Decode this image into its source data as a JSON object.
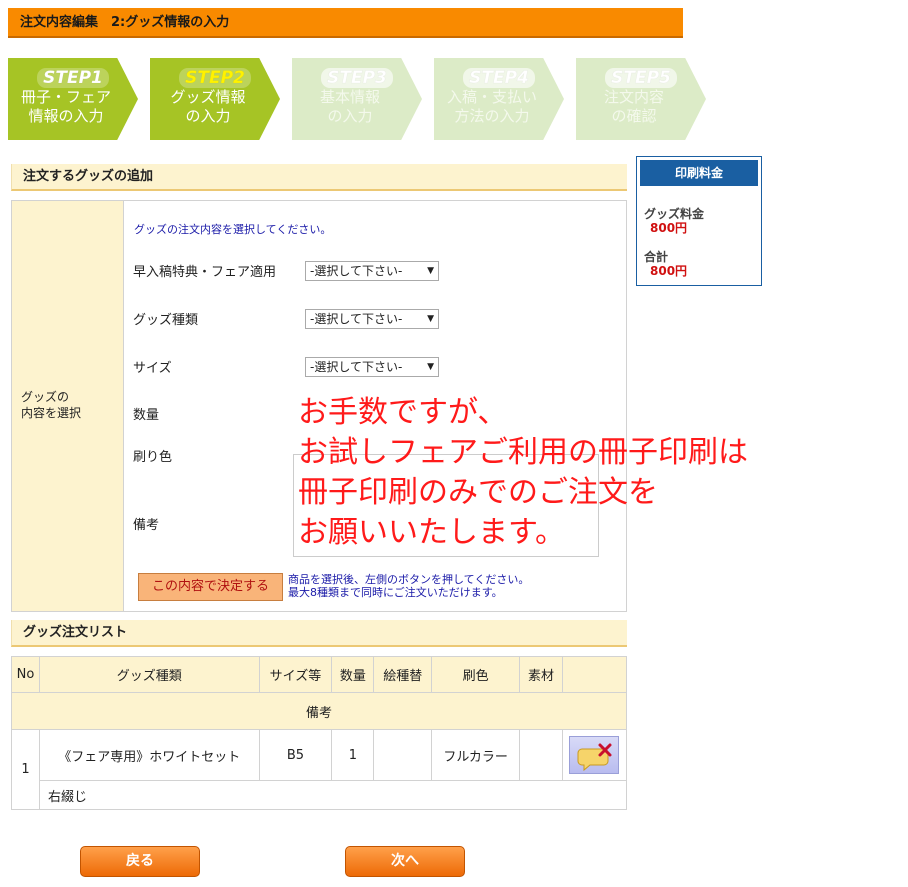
{
  "header": {
    "title": "注文内容編集　2:グッズ情報の入力"
  },
  "steps": [
    {
      "num": "STEP1",
      "line1": "冊子・フェア",
      "line2": "情報の入力"
    },
    {
      "num": "STEP2",
      "line1": "グッズ情報",
      "line2": "の入力"
    },
    {
      "num": "STEP3",
      "line1": "基本情報",
      "line2": "の入力"
    },
    {
      "num": "STEP4",
      "line1": "入稿・支払い",
      "line2": "方法の入力"
    },
    {
      "num": "STEP5",
      "line1": "注文内容",
      "line2": "の確認"
    }
  ],
  "add_section": {
    "title": "注文するグッズの追加",
    "left_label_1": "グッズの",
    "left_label_2": "内容を選択",
    "note": "グッズの注文内容を選択してください。",
    "fields": {
      "early": "早入稿特典・フェア適用",
      "type": "グッズ種類",
      "size": "サイズ",
      "qty": "数量",
      "color": "刷り色",
      "remarks": "備考"
    },
    "select_value": "-選択して下さい-",
    "decide_button": "この内容で決定する",
    "help_1": "商品を選択後、左側のボタンを押してください。",
    "help_2": "最大8種類まで同時にご注文いただけます。"
  },
  "overlay_message": {
    "line1": "お手数ですが、",
    "line2": "お試しフェアご利用の冊子印刷は",
    "line3": "冊子印刷のみでのご注文を",
    "line4": "お願いいたします。"
  },
  "price_box": {
    "title": "印刷料金",
    "goods_label": "グッズ料金",
    "goods_value": "800円",
    "total_label": "合計",
    "total_value": "800円"
  },
  "order_list": {
    "title": "グッズ注文リスト",
    "columns": [
      "No",
      "グッズ種類",
      "サイズ等",
      "数量",
      "絵種替",
      "刷色",
      "素材"
    ],
    "remarks_header": "備考",
    "rows": [
      {
        "no": "1",
        "type": "《フェア専用》ホワイトセット",
        "size": "B5",
        "qty": "1",
        "variation": "",
        "color": "フルカラー",
        "material": "",
        "remarks": "右綴じ"
      }
    ]
  },
  "nav": {
    "back": "戻る",
    "next": "次へ"
  },
  "colors": {
    "header": "#f98a00",
    "step_active": "#a6c425",
    "step_inactive": "#dcebc7",
    "price_head": "#1a5fa2"
  }
}
